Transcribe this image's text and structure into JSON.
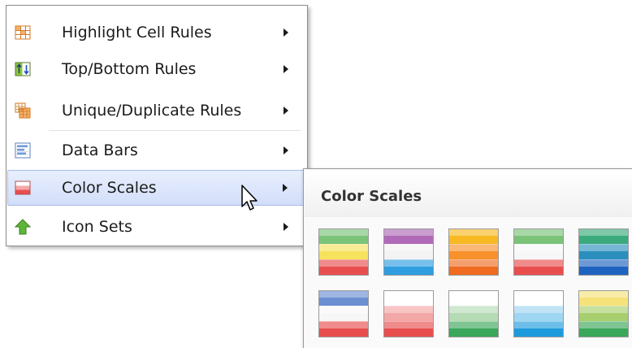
{
  "menu": {
    "items": [
      {
        "label": "Highlight Cell Rules",
        "icon": "highlight-cell-rules-icon"
      },
      {
        "label": "Top/Bottom Rules",
        "icon": "top-bottom-rules-icon"
      },
      {
        "label": "Unique/Duplicate Rules",
        "icon": "unique-duplicate-rules-icon"
      },
      {
        "label": "Data Bars",
        "icon": "data-bars-icon"
      },
      {
        "label": "Color Scales",
        "icon": "color-scales-icon",
        "active": true
      },
      {
        "label": "Icon Sets",
        "icon": "icon-sets-icon"
      }
    ],
    "submenu_arrow_icon": "chevron-right-icon"
  },
  "color_scales_panel": {
    "title": "Color Scales",
    "swatches": [
      {
        "name": "green-yellow-red",
        "colors": [
          "#7cc37a",
          "#f6e25c",
          "#e94e4e"
        ]
      },
      {
        "name": "purple-white-blue",
        "colors": [
          "#b06ab7",
          "#f3f3f3",
          "#2e9ee0"
        ]
      },
      {
        "name": "yellow-orange",
        "colors": [
          "#f8b923",
          "#f7912b",
          "#ef6b1f"
        ]
      },
      {
        "name": "green-white-red",
        "colors": [
          "#7cc37a",
          "#f7f7f7",
          "#e94e4e"
        ]
      },
      {
        "name": "green-blue",
        "colors": [
          "#3aaa7c",
          "#2b8fbd",
          "#1f63c0"
        ]
      },
      {
        "name": "blue-white-red",
        "colors": [
          "#6b8fd1",
          "#f7f7f7",
          "#e94e4e"
        ]
      },
      {
        "name": "white-red",
        "colors": [
          "#ffffff",
          "#f4a7a7",
          "#e94e4e"
        ]
      },
      {
        "name": "white-green",
        "colors": [
          "#ffffff",
          "#b5dcb5",
          "#3aa75a"
        ]
      },
      {
        "name": "white-blue",
        "colors": [
          "#ffffff",
          "#9fd6f1",
          "#1e9bdc"
        ]
      },
      {
        "name": "yellow-green",
        "colors": [
          "#f6e27a",
          "#a8cf6e",
          "#3aa75a"
        ]
      }
    ]
  },
  "colors": {
    "active_item_bg": "#d2defa",
    "active_item_border": "#a9bde9",
    "menu_border": "#8a8a8a"
  }
}
